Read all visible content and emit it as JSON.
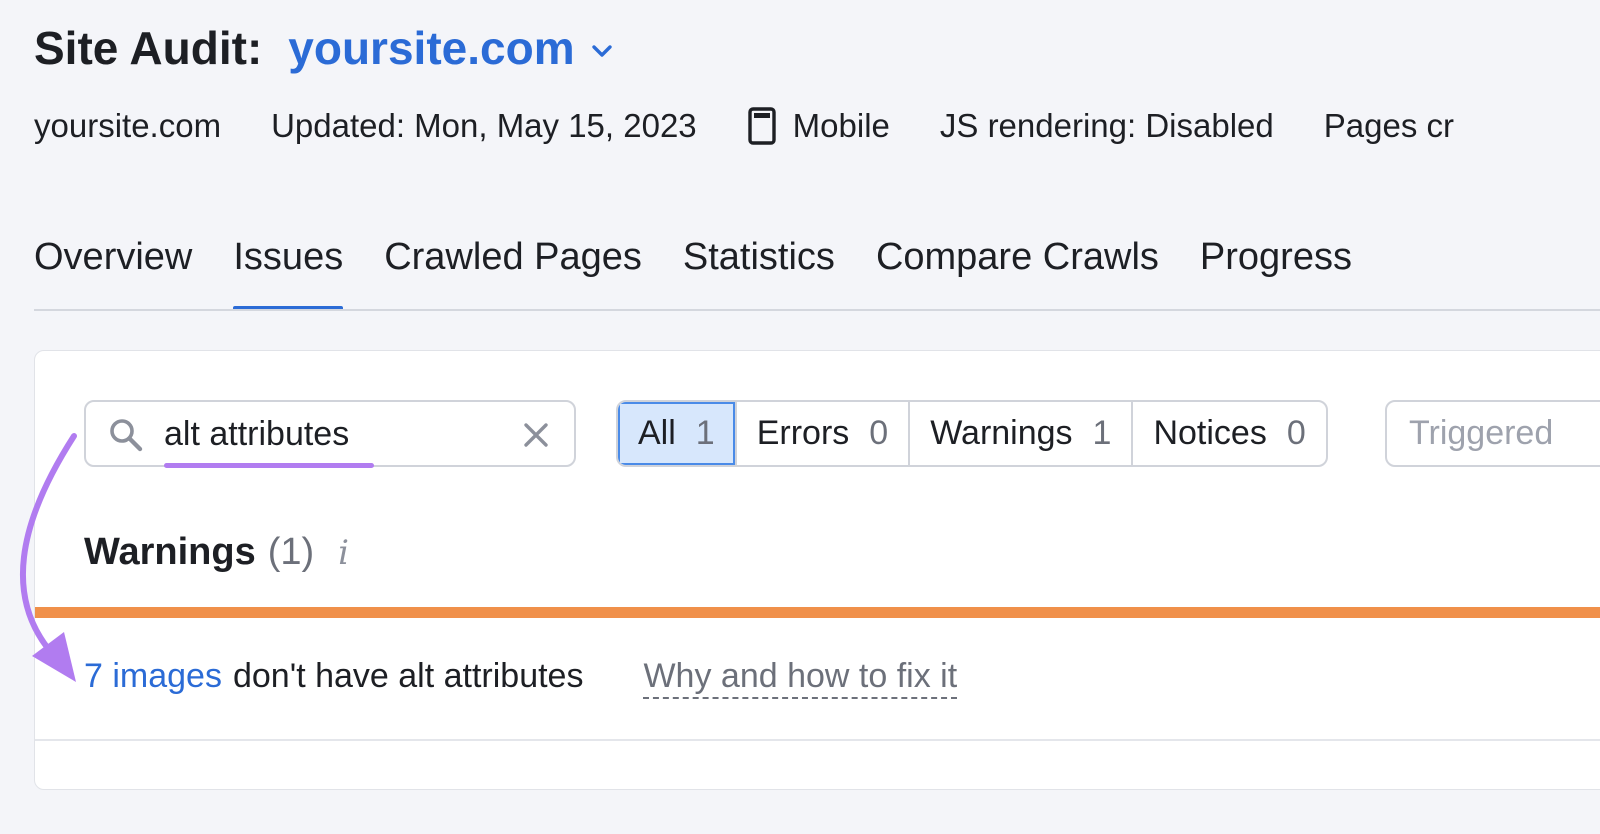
{
  "header": {
    "title_label": "Site Audit:",
    "site_name": "yoursite.com"
  },
  "meta": {
    "domain": "yoursite.com",
    "updated": "Updated: Mon, May 15, 2023",
    "device": "Mobile",
    "js_rendering": "JS rendering: Disabled",
    "pages_crawled": "Pages cr"
  },
  "tabs": [
    {
      "label": "Overview"
    },
    {
      "label": "Issues",
      "active": true
    },
    {
      "label": "Crawled Pages"
    },
    {
      "label": "Statistics"
    },
    {
      "label": "Compare Crawls"
    },
    {
      "label": "Progress"
    }
  ],
  "search": {
    "value": "alt attributes"
  },
  "filters": [
    {
      "label": "All",
      "count": "1",
      "active": true
    },
    {
      "label": "Errors",
      "count": "0"
    },
    {
      "label": "Warnings",
      "count": "1"
    },
    {
      "label": "Notices",
      "count": "0"
    }
  ],
  "triggered": {
    "placeholder": "Triggered"
  },
  "section": {
    "name": "Warnings",
    "count": "(1)",
    "info": "i"
  },
  "issue": {
    "link_text": "7 images",
    "text": "don't have alt attributes",
    "fix_link": "Why and how to fix it"
  },
  "colors": {
    "accent": "#2b6bd6",
    "warning_bar": "#f0904a",
    "highlight": "#b17cf0",
    "active_filter_bg": "#d7e7fc"
  }
}
